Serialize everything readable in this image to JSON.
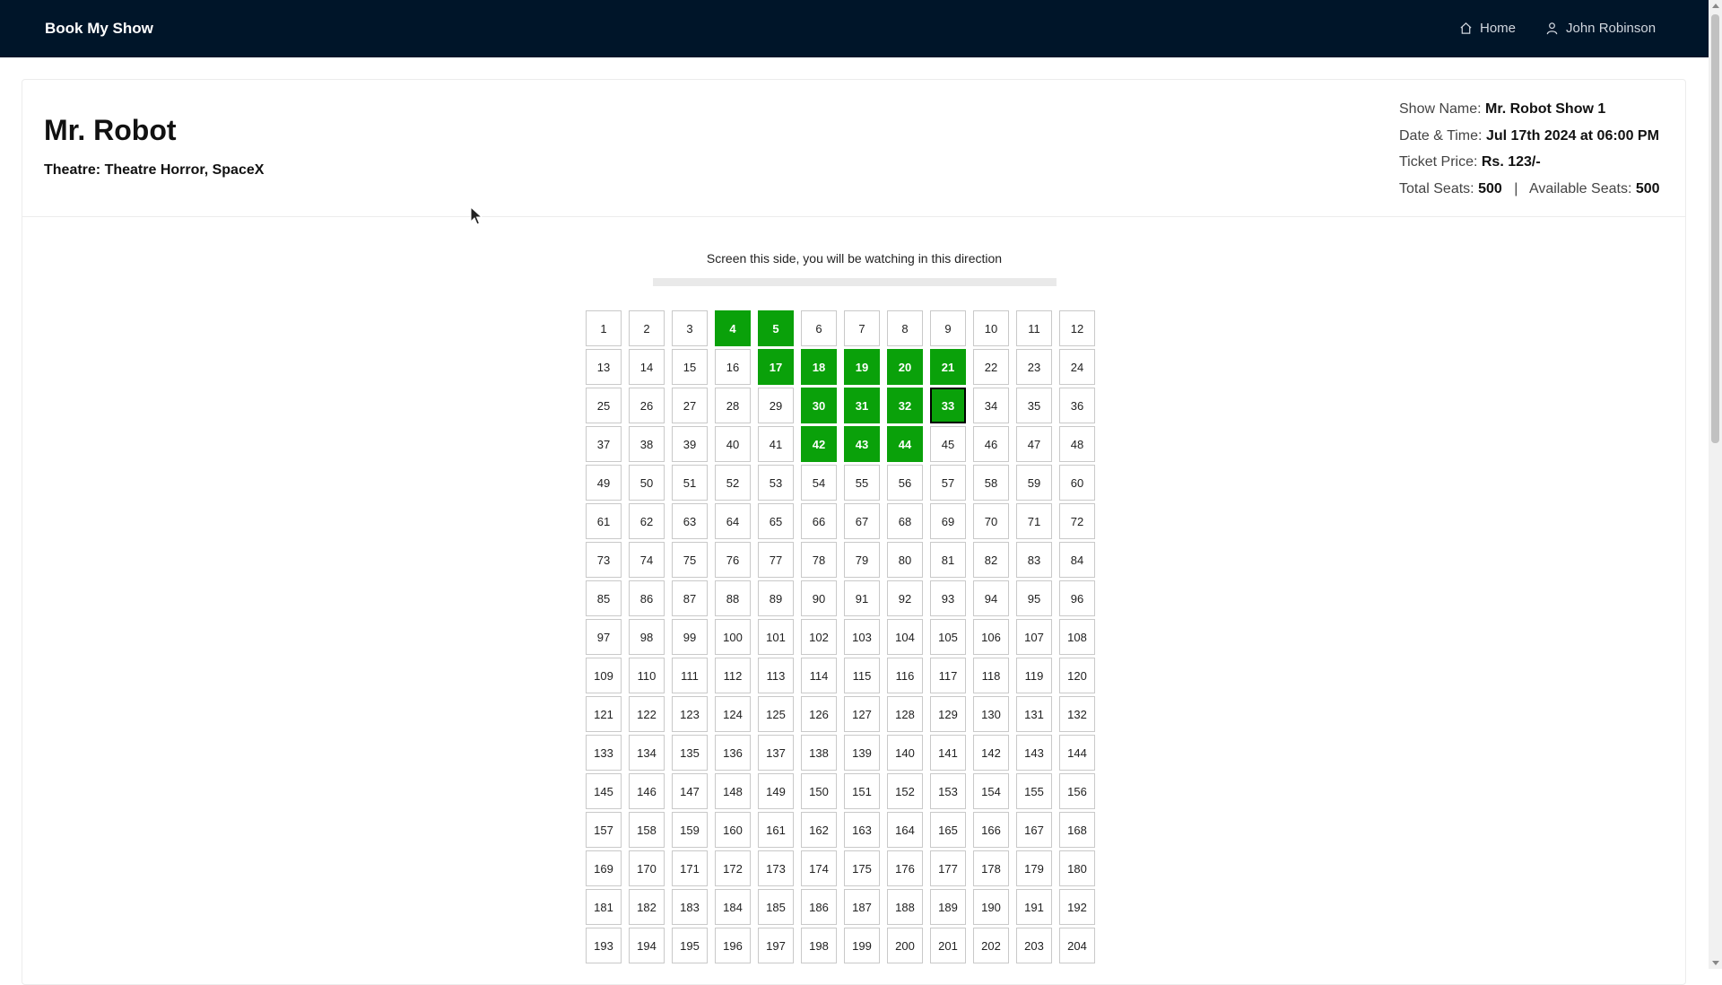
{
  "navbar": {
    "brand": "Book My Show",
    "home": "Home",
    "user": "John Robinson"
  },
  "movie": {
    "title": "Mr. Robot",
    "theatre": "Theatre: Theatre Horror, SpaceX"
  },
  "show_info": {
    "show_name_label": "Show Name:",
    "show_name": "Mr. Robot Show 1",
    "datetime_label": "Date & Time:",
    "datetime": "Jul 17th 2024 at 06:00 PM",
    "price_label": "Ticket Price:",
    "price": "Rs. 123/-",
    "total_label": "Total Seats:",
    "total": "500",
    "separator": "|",
    "available_label": "Available Seats:",
    "available": "500"
  },
  "screen": {
    "label": "Screen this side, you will be watching in this direction"
  },
  "seats": {
    "columns": 12,
    "visible_count": 204,
    "selected": [
      4,
      5,
      17,
      18,
      19,
      20,
      21,
      30,
      31,
      32,
      33,
      42,
      43,
      44
    ],
    "focused": 33
  },
  "colors": {
    "navbar_bg": "#001529",
    "selected_seat": "#0aa10a"
  }
}
